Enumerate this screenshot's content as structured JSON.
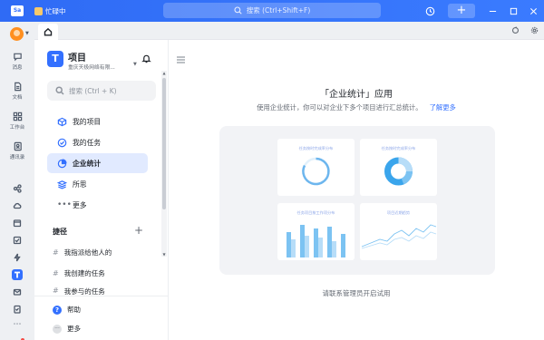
{
  "titlebar": {
    "app_badge": "Sa",
    "status": "忙碌中",
    "search_placeholder": "搜索 (Ctrl+Shift+F)",
    "add_label": "+"
  },
  "rail": {
    "items": [
      {
        "label": "消息",
        "icon": "message-icon"
      },
      {
        "label": "文档",
        "icon": "doc-icon"
      },
      {
        "label": "工作台",
        "icon": "workbench-icon"
      },
      {
        "label": "通讯录",
        "icon": "contacts-icon"
      }
    ]
  },
  "sidebar": {
    "logo": "T",
    "title": "项目",
    "org": "重庆天极网络有限...",
    "search_placeholder": "搜索 (Ctrl + K)",
    "nav": [
      {
        "label": "我的项目",
        "icon": "cube-icon"
      },
      {
        "label": "我的任务",
        "icon": "check-circle-icon"
      },
      {
        "label": "企业统计",
        "icon": "pie-chart-icon",
        "active": true
      },
      {
        "label": "所思",
        "icon": "layers-icon"
      },
      {
        "label": "更多",
        "icon": "more-icon"
      }
    ],
    "shortcuts_header": "捷径",
    "shortcuts": [
      "我指派给他人的",
      "我创建的任务",
      "我参与的任务"
    ],
    "bottom": [
      {
        "label": "帮助",
        "icon": "help-icon"
      },
      {
        "label": "更多",
        "icon": "more-icon"
      }
    ]
  },
  "main": {
    "title": "「企业统计」应用",
    "subtitle": "使用企业统计，你可以对企业下多个项目进行汇总统计。",
    "learn_more": "了解更多",
    "cards": [
      "任务按时完成率分布",
      "任务按时完成率分布",
      "任务项目按工作项分布",
      "项目近期趋势"
    ],
    "footer": "请联系管理员开启试用"
  },
  "colors": {
    "accent": "#3370ff",
    "chart_light": "#b7ddf8",
    "chart_mid": "#7cc3f2",
    "chart_dark": "#3aa5ec"
  }
}
